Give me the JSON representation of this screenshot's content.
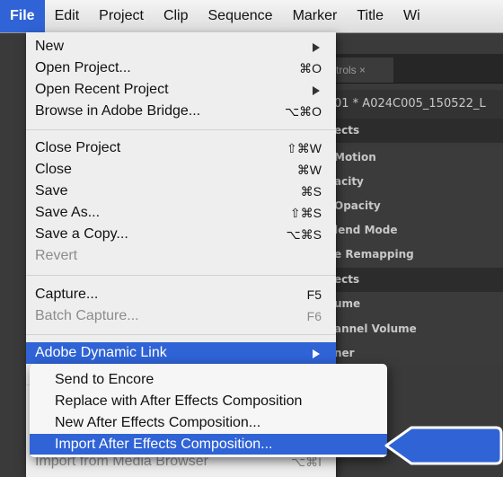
{
  "menubar": {
    "items": [
      "File",
      "Edit",
      "Project",
      "Clip",
      "Sequence",
      "Marker",
      "Title",
      "Wi"
    ]
  },
  "background": {
    "effect_controls_tab": "trols ×",
    "clip_name": "01 * A024C005_150522_L",
    "rows": [
      "ects",
      "Motion",
      "acity",
      "Opacity",
      "lend Mode",
      "e Remapping",
      "ects",
      "ume",
      "annel Volume",
      "ner"
    ]
  },
  "file_menu": {
    "items": [
      {
        "label": "New",
        "shortcut": "",
        "submenu": true,
        "disabled": false
      },
      {
        "label": "Open Project...",
        "shortcut": "⌘O",
        "submenu": false,
        "disabled": false
      },
      {
        "label": "Open Recent Project",
        "shortcut": "",
        "submenu": true,
        "disabled": false
      },
      {
        "label": "Browse in Adobe Bridge...",
        "shortcut": "⌥⌘O",
        "submenu": false,
        "disabled": false
      },
      {
        "label": "Close Project",
        "shortcut": "⇧⌘W",
        "submenu": false,
        "disabled": false
      },
      {
        "label": "Close",
        "shortcut": "⌘W",
        "submenu": false,
        "disabled": false
      },
      {
        "label": "Save",
        "shortcut": "⌘S",
        "submenu": false,
        "disabled": false
      },
      {
        "label": "Save As...",
        "shortcut": "⇧⌘S",
        "submenu": false,
        "disabled": false
      },
      {
        "label": "Save a Copy...",
        "shortcut": "⌥⌘S",
        "submenu": false,
        "disabled": false
      },
      {
        "label": "Revert",
        "shortcut": "",
        "submenu": false,
        "disabled": true
      },
      {
        "label": "Capture...",
        "shortcut": "F5",
        "submenu": false,
        "disabled": false
      },
      {
        "label": "Batch Capture...",
        "shortcut": "F6",
        "submenu": false,
        "disabled": true
      },
      {
        "label": "Adobe Dynamic Link",
        "shortcut": "",
        "submenu": true,
        "disabled": false,
        "highlighted": true
      },
      {
        "label": "Import from Media Browser",
        "shortcut": "⌥⌘I",
        "submenu": false,
        "disabled": true
      }
    ]
  },
  "dynamic_link_submenu": {
    "items": [
      {
        "label": "Send to Encore",
        "highlighted": false
      },
      {
        "label": "Replace with After Effects Composition",
        "highlighted": false
      },
      {
        "label": "New After Effects Composition...",
        "highlighted": false
      },
      {
        "label": "Import After Effects Composition...",
        "highlighted": true
      }
    ]
  },
  "colors": {
    "highlight": "#2f63d6",
    "callout": "#2f63d6"
  }
}
